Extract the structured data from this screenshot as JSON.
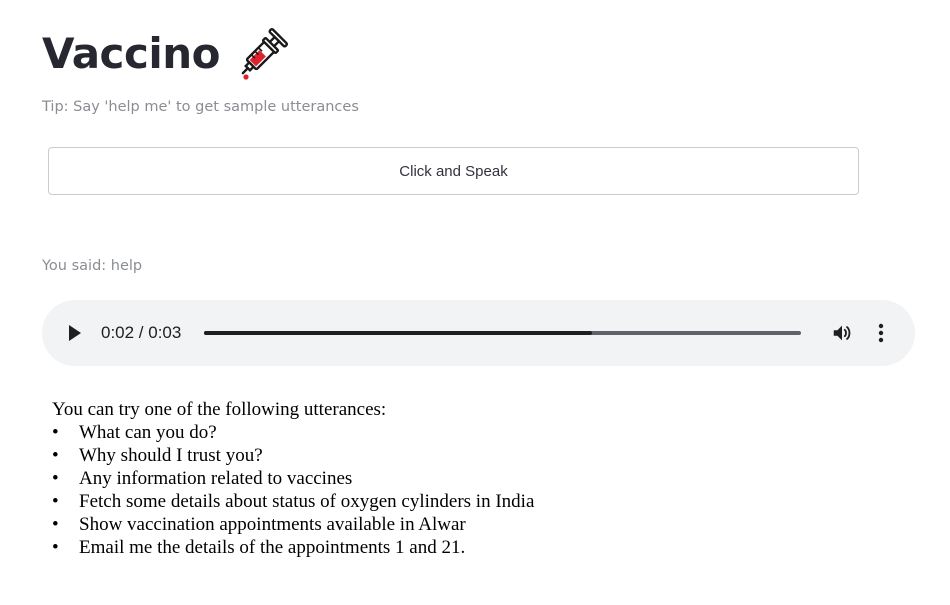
{
  "header": {
    "title": "Vaccino",
    "title_icon": "syringe-icon"
  },
  "tip": "Tip: Say 'help me' to get sample utterances",
  "speak_button": {
    "label": "Click and Speak"
  },
  "transcript": "You said: help",
  "audio": {
    "time": "0:02 / 0:03",
    "progress_fraction": 0.65,
    "icons": [
      "play-icon",
      "volume-icon",
      "more-options-icon"
    ]
  },
  "utterances": {
    "intro": "You can try one of the following utterances:",
    "items": [
      "What can you do?",
      "Why should I trust you?",
      "Any information related to vaccines",
      "Fetch some details about status of oxygen cylinders in India",
      "Show vaccination appointments available in Alwar",
      "Email me the details of the appointments 1 and 21."
    ]
  },
  "colors": {
    "text_dark": "#262730",
    "muted": "#8a8d93",
    "player_bg": "#f1f3f4",
    "syringe_red": "#e0202a"
  }
}
